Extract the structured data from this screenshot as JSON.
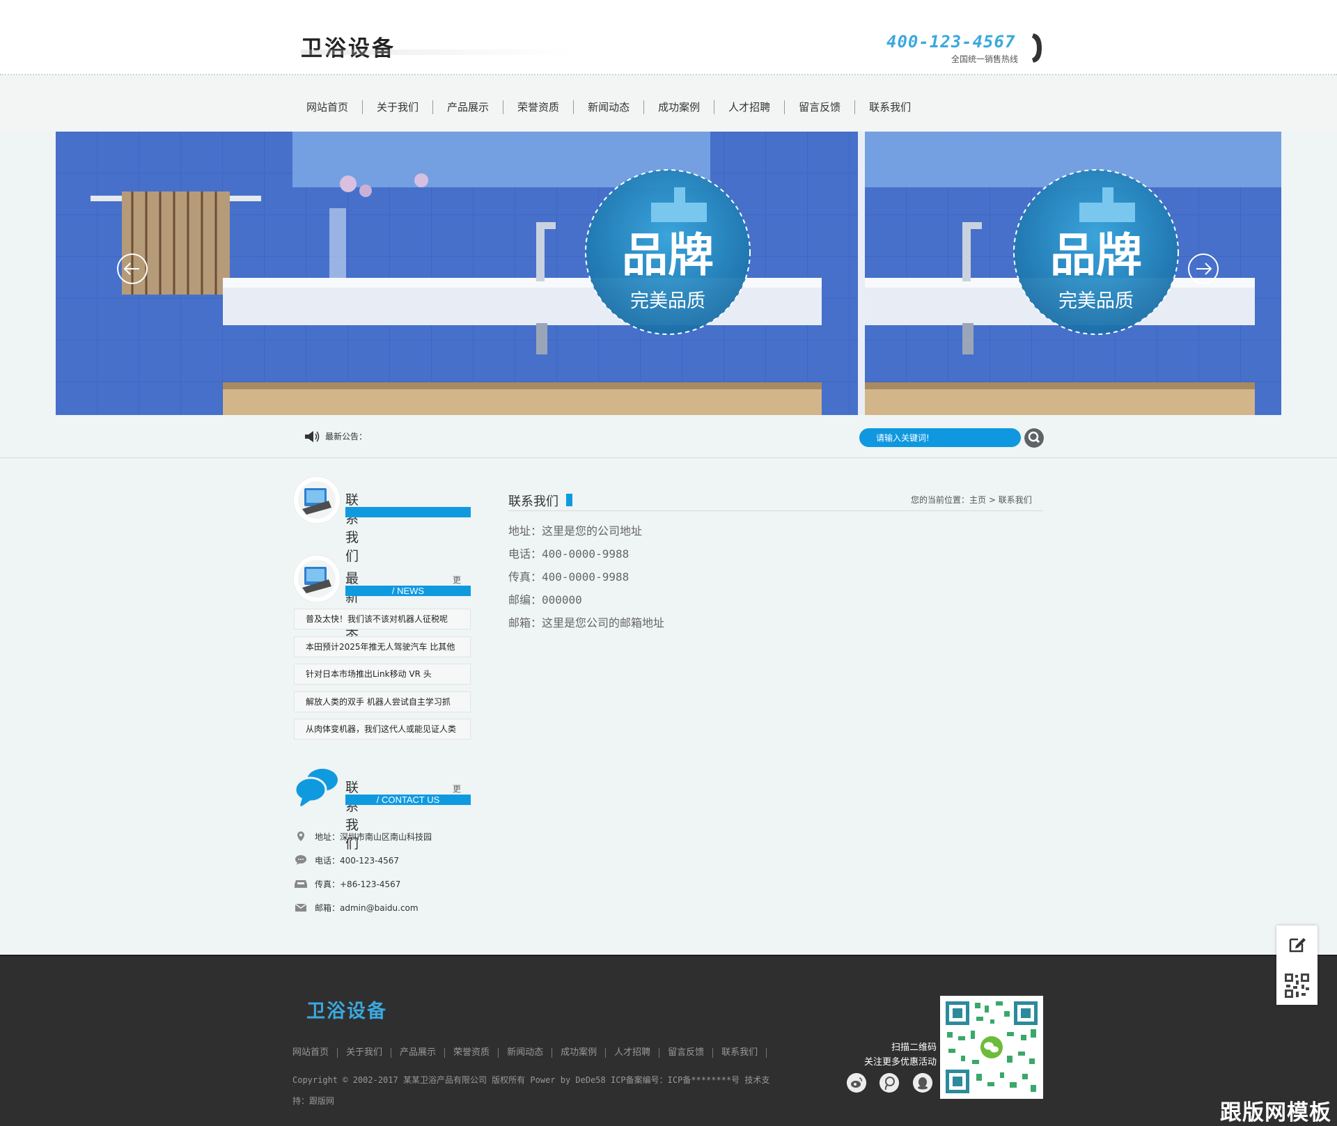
{
  "header": {
    "logo_text": "卫浴设备",
    "hotline_number": "400-123-4567",
    "hotline_label": "全国统一销售热线"
  },
  "nav": {
    "items": [
      "网站首页",
      "关于我们",
      "产品展示",
      "荣誉资质",
      "新闻动态",
      "成功案例",
      "人才招聘",
      "留言反馈",
      "联系我们"
    ]
  },
  "banner": {
    "badge_title": "品牌",
    "badge_subtitle": "完美品质"
  },
  "notice": {
    "label": "最新公告："
  },
  "search": {
    "placeholder": "请输入关键词!"
  },
  "sidebar": {
    "contact_title": "联系我们",
    "news": {
      "title": "最新动态",
      "more": "更多",
      "subtitle": "/ NEWS",
      "items": [
        "普及太快！我们该不该对机器人征税呢",
        "本田预计2025年推无人驾驶汽车 比其他",
        "针对日本市场推出Link移动 VR 头",
        "解放人类的双手 机器人尝试自主学习抓",
        "从肉体变机器，我们这代人或能见证人类"
      ]
    },
    "contact_us": {
      "title": "联系我们",
      "more": "更多",
      "subtitle": "/ CONTACT US",
      "address": "地址：深圳市南山区南山科技园",
      "phone": "电话：400-123-4567",
      "fax": "传真：+86-123-4567",
      "email": "邮箱：admin@baidu.com"
    }
  },
  "main": {
    "title": "联系我们",
    "breadcrumb_prefix": "您的当前位置：",
    "breadcrumb_home": "主页",
    "breadcrumb_sep": ">",
    "breadcrumb_current": "联系我们",
    "lines": [
      "地址：这里是您的公司地址",
      "电话：400-0000-9988",
      "传真：400-0000-9988",
      "邮编：000000",
      "邮箱：这里是您公司的邮箱地址"
    ]
  },
  "footer": {
    "logo_text": "卫浴设备",
    "links": [
      "网站首页",
      "关于我们",
      "产品展示",
      "荣誉资质",
      "新闻动态",
      "成功案例",
      "人才招聘",
      "留言反馈",
      "联系我们"
    ],
    "copyright_line1": "Copyright © 2002-2017 某某卫浴产品有限公司 版权所有 Power by DeDe58    ICP备案编号：ICP备********号    技术支",
    "copyright_line2": "持：跟版网",
    "qr_label_1": "扫描二维码",
    "qr_label_2": "关注更多优惠活动",
    "watermark": "跟版网模板"
  },
  "colors": {
    "accent": "#0f9ae0",
    "hotline": "#3aa8de",
    "footer_bg": "#2f2f2f",
    "page_bg": "#eff4f4",
    "banner_tile": "#3d65c0"
  },
  "icons": {
    "notice": "speaker-icon",
    "search": "magnifier-icon",
    "slide_prev": "arrow-left-icon",
    "slide_next": "arrow-right-icon",
    "address": "map-pin-icon",
    "phone": "chat-bubble-icon",
    "fax": "inbox-icon",
    "email": "envelope-icon",
    "social": [
      "weibo-icon",
      "tencent-weibo-icon",
      "qq-icon"
    ],
    "float": [
      "edit-icon",
      "qr-code-icon"
    ]
  }
}
